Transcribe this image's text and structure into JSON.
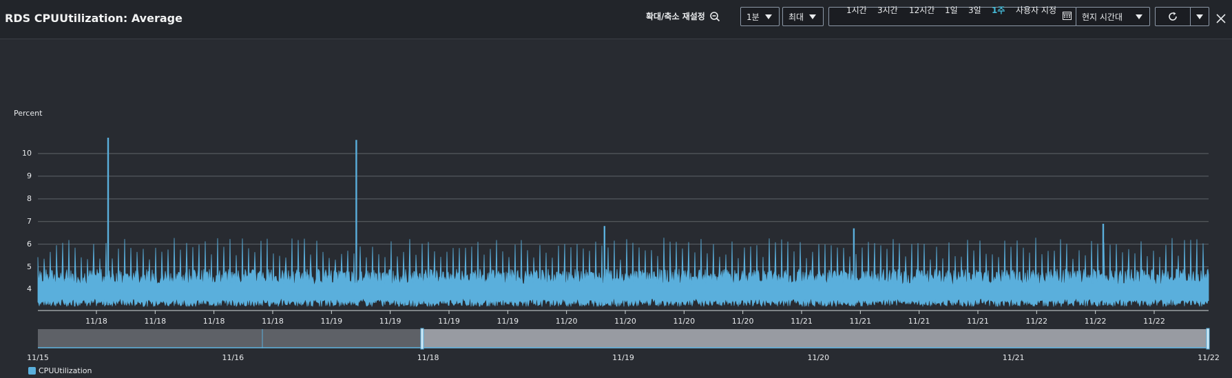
{
  "header": {
    "title": "RDS CPUUtilization: Average",
    "zoom_reset": "확대/축소 재설정",
    "period": "1분",
    "statistic": "최대",
    "ranges": [
      {
        "label": "1시간",
        "active": false
      },
      {
        "label": "3시간",
        "active": false
      },
      {
        "label": "12시간",
        "active": false
      },
      {
        "label": "1일",
        "active": false
      },
      {
        "label": "3일",
        "active": false
      },
      {
        "label": "1주",
        "active": true
      },
      {
        "label": "사용자 지정",
        "active": false
      }
    ],
    "timezone": "현지 시간대"
  },
  "colors": {
    "series": "#5aafdc",
    "accent": "#44b9d6",
    "background": "#282b31",
    "grid": "#5f6469"
  },
  "chart_data": [
    {
      "type": "line",
      "ylabel": "Percent",
      "yticks": [
        4,
        5,
        6,
        7,
        8,
        9,
        10
      ],
      "ylim": [
        3.1,
        10.7
      ],
      "grid": true,
      "xtick_labels": [
        "11/18",
        "11/18",
        "11/18",
        "11/18",
        "11/19",
        "11/19",
        "11/19",
        "11/19",
        "11/20",
        "11/20",
        "11/20",
        "11/20",
        "11/21",
        "11/21",
        "11/21",
        "11/21",
        "11/22",
        "11/22",
        "11/22"
      ],
      "series": [
        {
          "name": "CPUUtilization",
          "baseline_range": [
            3.4,
            4.8
          ],
          "periodic_peak_range": [
            5.3,
            6.3
          ],
          "peaks": [
            {
              "x": "11/18",
              "y": 10.7
            },
            {
              "x": "11/19",
              "y": 10.6
            },
            {
              "x": "11/20",
              "y": 6.8
            },
            {
              "x": "11/21",
              "y": 6.7
            },
            {
              "x": "11/22",
              "y": 6.9
            }
          ]
        }
      ],
      "legend": [
        "CPUUtilization"
      ],
      "legend_position": "bottom-left"
    },
    {
      "type": "area",
      "role": "overview-navigator",
      "xtick_labels": [
        "11/15",
        "11/16",
        "11/18",
        "11/19",
        "11/20",
        "11/21",
        "11/22"
      ],
      "selected_range": [
        "11/18",
        "11/22"
      ]
    }
  ],
  "legend": {
    "label": "CPUUtilization"
  }
}
